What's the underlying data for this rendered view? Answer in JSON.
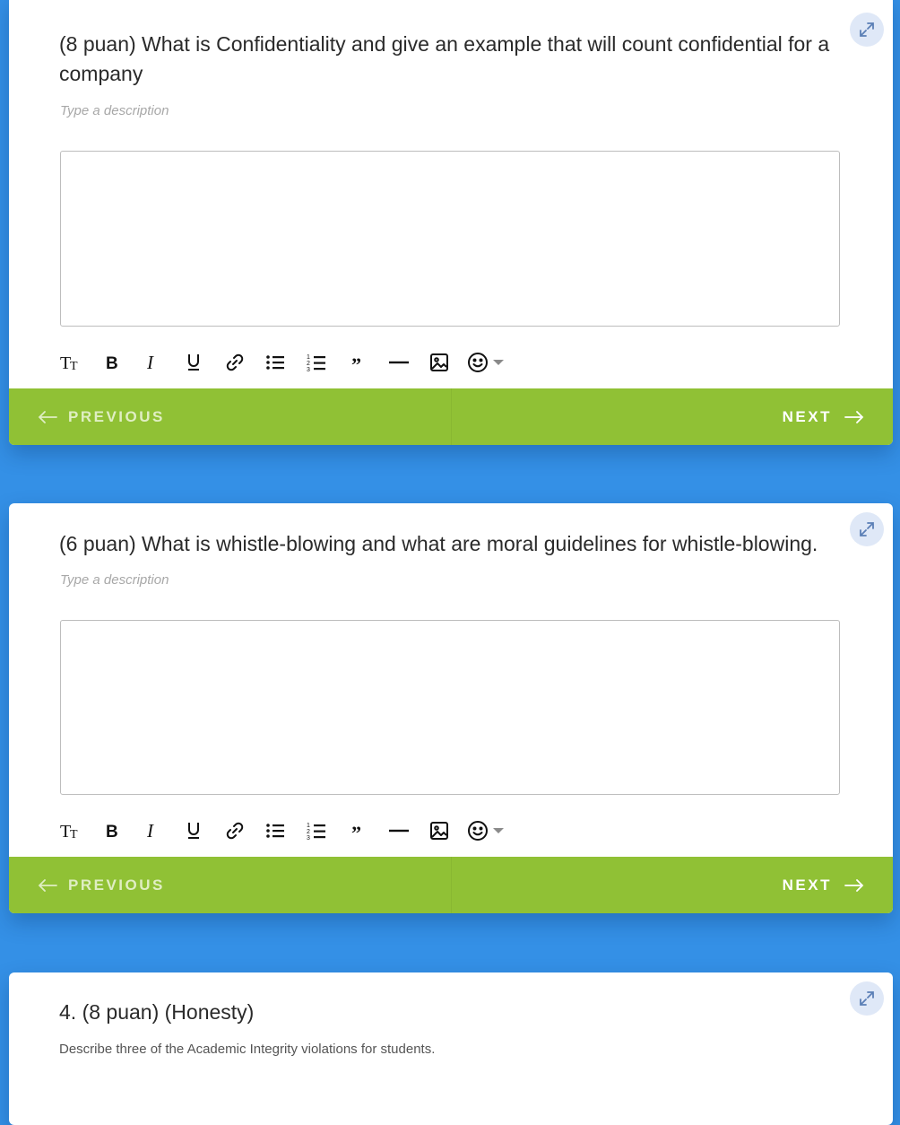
{
  "questions": [
    {
      "title": "(8 puan) What is Confidentiality and give an example that will count confidential for a company",
      "description_placeholder": "Type a description",
      "answer_value": ""
    },
    {
      "title": "(6 puan) What is whistle-blowing and what are moral guidelines for whistle-blowing.",
      "description_placeholder": "Type a description",
      "answer_value": ""
    },
    {
      "title": "4. (8 puan) (Honesty)",
      "description": "Describe three of the Academic Integrity violations for students."
    }
  ],
  "toolbar_icons": [
    "text-size-icon",
    "bold-icon",
    "italic-icon",
    "underline-icon",
    "link-icon",
    "bullet-list-icon",
    "numbered-list-icon",
    "quote-icon",
    "horizontal-rule-icon",
    "image-icon",
    "emoji-icon"
  ],
  "nav": {
    "previous_label": "PREVIOUS",
    "next_label": "NEXT"
  },
  "colors": {
    "background": "#3490e6",
    "nav_bar": "#90c135",
    "expand_button": "#dfe8f7"
  }
}
